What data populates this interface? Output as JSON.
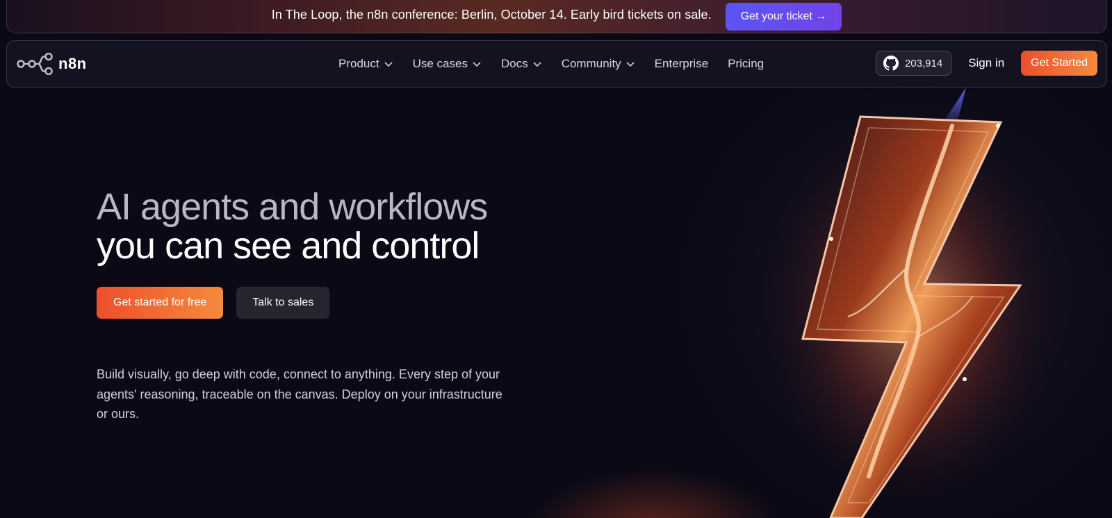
{
  "banner": {
    "text": "In The Loop, the n8n conference: Berlin, October 14. Early bird tickets on sale.",
    "button_label": "Get your ticket →"
  },
  "navbar": {
    "logo_text": "n8n",
    "items": [
      {
        "label": "Product",
        "has_dropdown": true
      },
      {
        "label": "Use cases",
        "has_dropdown": true
      },
      {
        "label": "Docs",
        "has_dropdown": true
      },
      {
        "label": "Community",
        "has_dropdown": true
      },
      {
        "label": "Enterprise",
        "has_dropdown": false
      },
      {
        "label": "Pricing",
        "has_dropdown": false
      }
    ],
    "github_stars": "203,914",
    "signin_label": "Sign in",
    "get_started_label": "Get Started"
  },
  "hero": {
    "title_line1": "AI agents and workflows",
    "title_line2": "you can see and control",
    "primary_cta": "Get started for free",
    "secondary_cta": "Talk to sales",
    "subtitle": "Build visually, go deep with code, connect to anything. Every step of your agents' reasoning, traceable on the canvas. Deploy on your infrastructure or ours."
  },
  "icons": {
    "logo": "n8n-logo-icon",
    "github": "github-icon",
    "dropdown": "chevron-down-icon",
    "hero_art": "lightning-bolt-illustration"
  },
  "colors": {
    "background": "#0a0915",
    "accent_orange": "#ee4e2c",
    "accent_orange_light": "#f58a3c",
    "banner_button": "#5b55f2",
    "secondary_button": "#26252f"
  }
}
